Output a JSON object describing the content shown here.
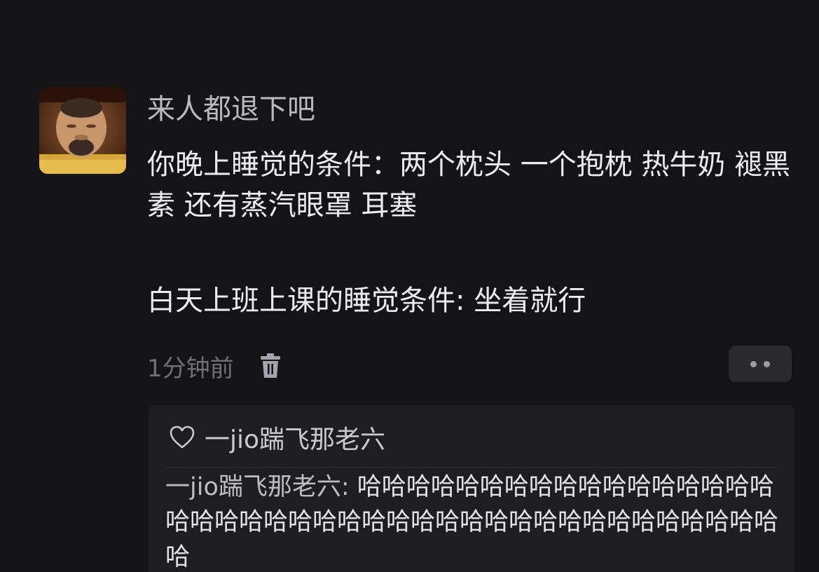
{
  "comment": {
    "username": "来人都退下吧",
    "text_line1": "你晚上睡觉的条件：两个枕头 一个抱枕 热牛奶 褪黑素 还有蒸汽眼罩 耳塞",
    "text_line2": "白天上班上课的睡觉条件: 坐着就行",
    "timestamp": "1分钟前",
    "delete_icon": "trash-icon",
    "more_icon": "more-dots-icon"
  },
  "reply_section": {
    "like_icon": "heart-outline-icon",
    "liked_by": "一jio踹飞那老六",
    "reply_author": "一jio踹飞那老六:",
    "reply_text": " 哈哈哈哈哈哈哈哈哈哈哈哈哈哈哈哈哈哈哈哈哈哈哈哈哈哈哈哈哈哈哈哈哈哈哈哈哈哈哈哈哈哈哈"
  },
  "colors": {
    "background": "#141416",
    "reply_background": "#1e1e22",
    "username": "#b9b9c0",
    "timestamp": "#6f6f76"
  }
}
